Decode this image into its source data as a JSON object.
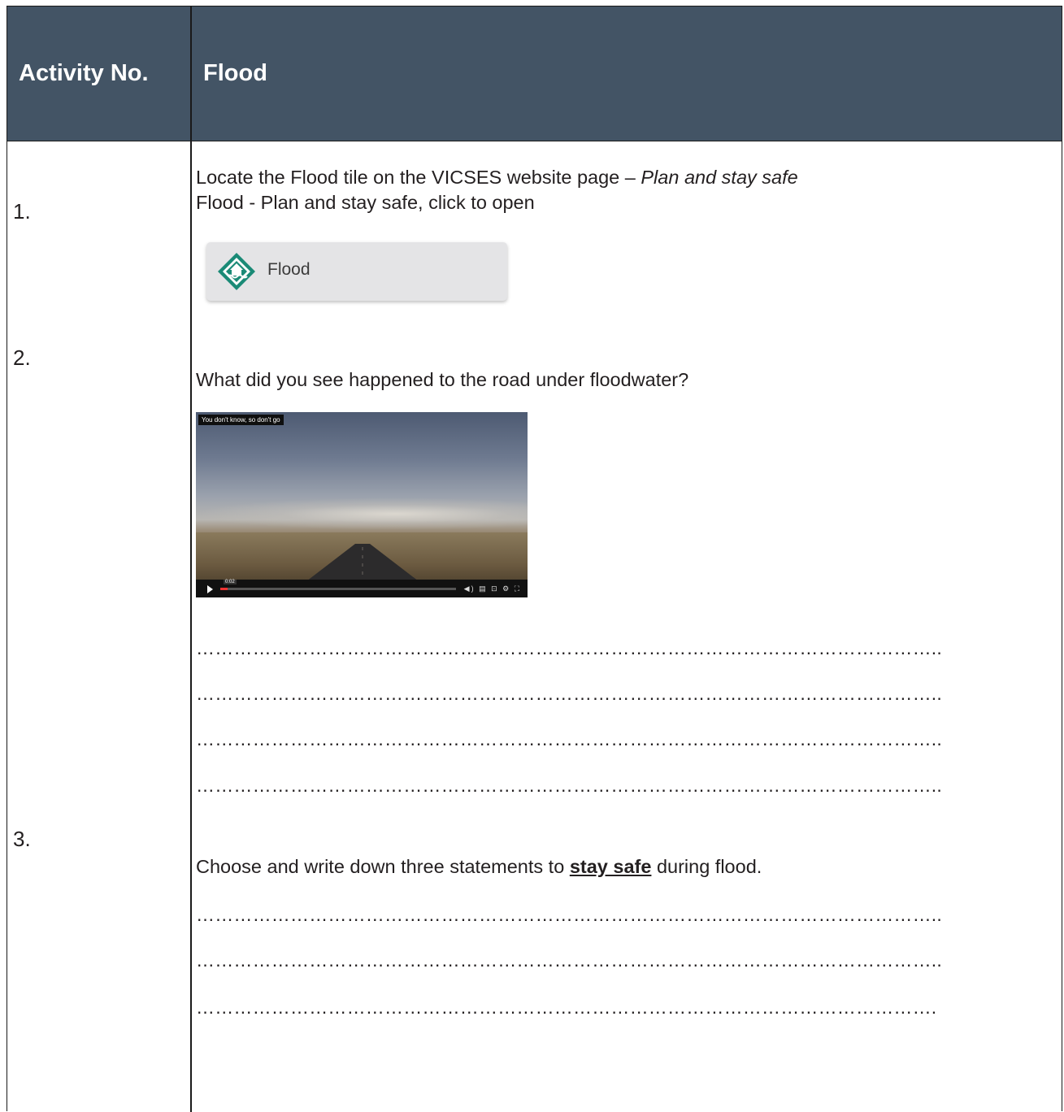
{
  "header": {
    "col1": "Activity No.",
    "col2": "Flood"
  },
  "activity1": {
    "number": "1.",
    "line1_prefix": "Locate the Flood tile on the VICSES website page – ",
    "line1_italic": "Plan and stay safe",
    "line2": "Flood - Plan and stay safe, click to open",
    "tile_label": "Flood"
  },
  "activity2": {
    "number": "2.",
    "question": "What did you see happened to the road under floodwater?",
    "video_caption": "You don't know, so don't go",
    "video_time": "0:02",
    "video_progress": 0.03
  },
  "activity3": {
    "number": "3.",
    "prefix": "Choose and write down three statements to ",
    "emphasis": "stay safe",
    "suffix": " during flood."
  },
  "answer_line": "………………………………………………………………………………………………………..",
  "answer_line_last": "……………………………………………………………………………………………………….",
  "colors": {
    "header_bg": "#435465",
    "tile_icon": "#1a8a76",
    "tile_bg": "#e4e4e6"
  }
}
